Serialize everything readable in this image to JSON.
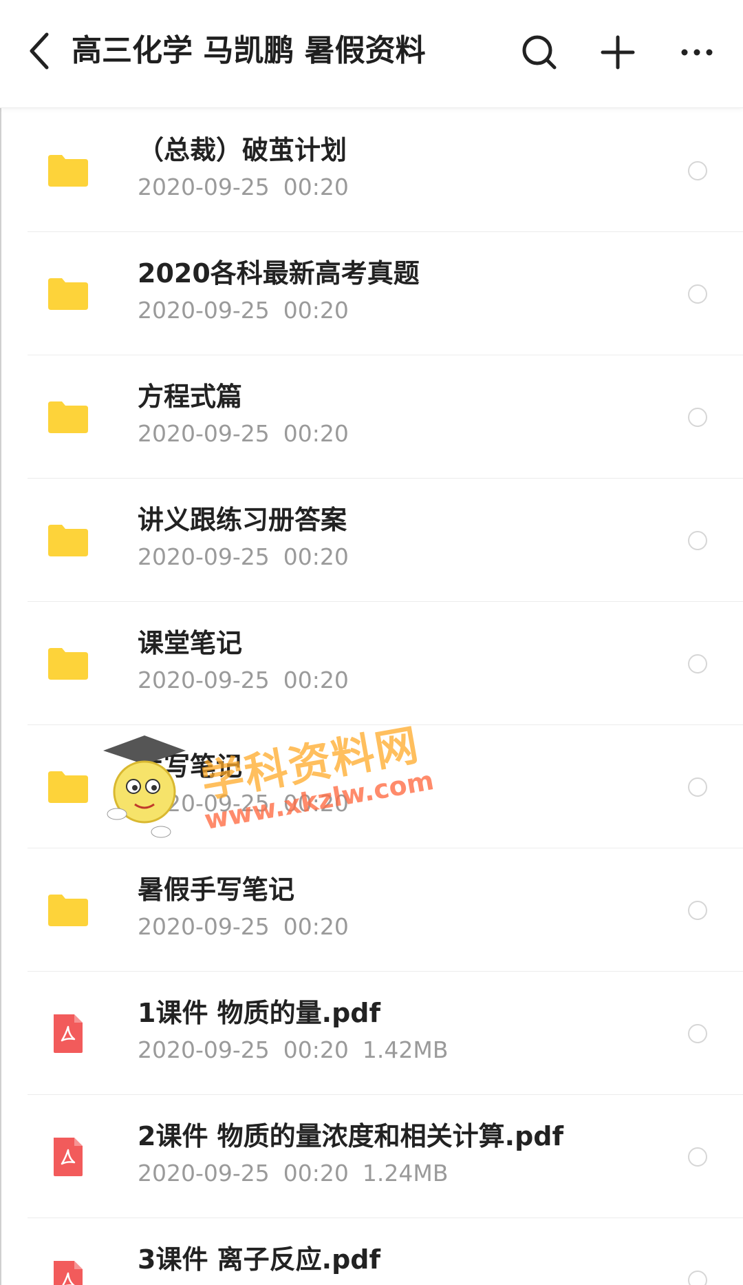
{
  "header": {
    "title": "高三化学 马凯鹏 暑假资料",
    "back_icon": "chevron-left-icon",
    "actions": [
      {
        "icon": "search-icon"
      },
      {
        "icon": "plus-icon"
      },
      {
        "icon": "more-horizontal-icon"
      }
    ]
  },
  "colors": {
    "folder": "#FDD33A",
    "pdf": "#F25B5B",
    "title_text": "#1f1f1f",
    "meta_text": "#9a9a9a",
    "divider": "#ececec"
  },
  "files": [
    {
      "name": "（总裁）破茧计划",
      "date": "2020-09-25",
      "time": "00:20",
      "size": "",
      "type": "folder"
    },
    {
      "name": "2020各科最新高考真题",
      "date": "2020-09-25",
      "time": "00:20",
      "size": "",
      "type": "folder"
    },
    {
      "name": "方程式篇",
      "date": "2020-09-25",
      "time": "00:20",
      "size": "",
      "type": "folder"
    },
    {
      "name": "讲义跟练习册答案",
      "date": "2020-09-25",
      "time": "00:20",
      "size": "",
      "type": "folder"
    },
    {
      "name": "课堂笔记",
      "date": "2020-09-25",
      "time": "00:20",
      "size": "",
      "type": "folder"
    },
    {
      "name": "手写笔记",
      "date": "2020-09-25",
      "time": "00:20",
      "size": "",
      "type": "folder"
    },
    {
      "name": "暑假手写笔记",
      "date": "2020-09-25",
      "time": "00:20",
      "size": "",
      "type": "folder"
    },
    {
      "name": "1课件 物质的量.pdf",
      "date": "2020-09-25",
      "time": "00:20",
      "size": "1.42MB",
      "type": "pdf"
    },
    {
      "name": "2课件 物质的量浓度和相关计算.pdf",
      "date": "2020-09-25",
      "time": "00:20",
      "size": "1.24MB",
      "type": "pdf"
    },
    {
      "name": "3课件 离子反应.pdf",
      "date": "",
      "time": "",
      "size": "",
      "type": "pdf"
    }
  ],
  "watermark": {
    "title": "学科资料网",
    "url": "www.xkzlw.com"
  }
}
